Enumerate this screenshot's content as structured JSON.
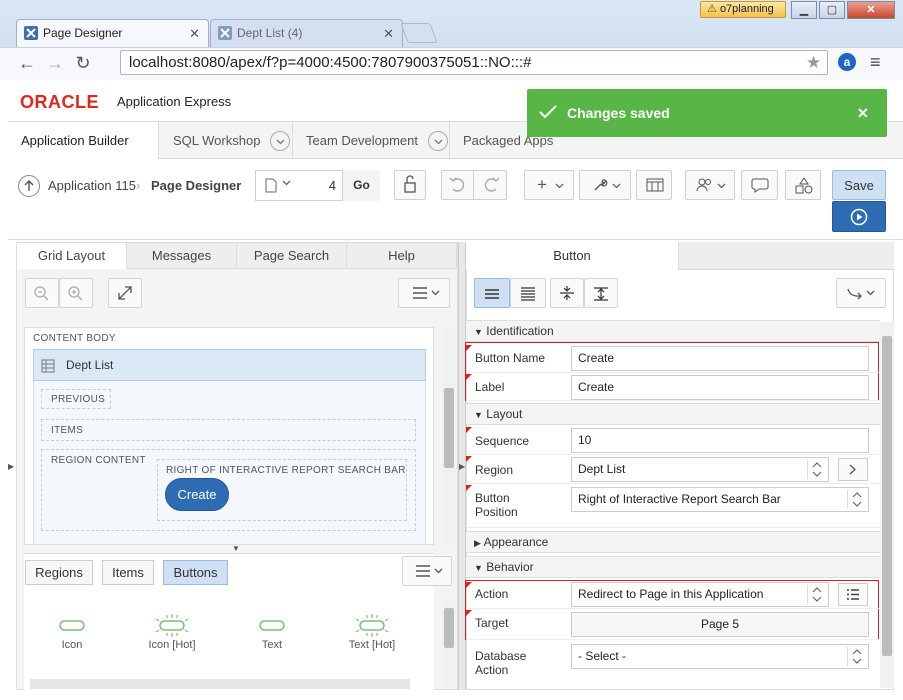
{
  "browser": {
    "tabs": [
      {
        "title": "Page Designer",
        "active": true
      },
      {
        "title": "Dept List (4)",
        "active": false
      }
    ],
    "url": "localhost:8080/apex/f?p=4000:4500:7807900375051::NO:::#",
    "user": "o7planning"
  },
  "header": {
    "brand": "ORACLE",
    "product": "Application Express",
    "tabs": [
      "Application Builder",
      "SQL Workshop",
      "Team Development",
      "Packaged Apps"
    ]
  },
  "toast": {
    "message": "Changes saved"
  },
  "toolbar": {
    "breadcrumb_app": "Application 115",
    "breadcrumb_page": "Page Designer",
    "page_number": "4",
    "go_label": "Go",
    "save_label": "Save"
  },
  "left": {
    "tabs": [
      "Grid Layout",
      "Messages",
      "Page Search",
      "Help"
    ],
    "grid": {
      "content_body": "CONTENT BODY",
      "region_title": "Dept List",
      "previous": "PREVIOUS",
      "items": "ITEMS",
      "region_content": "REGION CONTENT",
      "right_of_bar": "RIGHT OF INTERACTIVE REPORT SEARCH BAR",
      "create_button": "Create"
    },
    "gallery_tabs": [
      "Regions",
      "Items",
      "Buttons"
    ],
    "gallery_items": [
      "Icon",
      "Icon [Hot]",
      "Text",
      "Text [Hot]"
    ]
  },
  "right": {
    "tab": "Button",
    "sections": {
      "identification": "Identification",
      "layout": "Layout",
      "appearance": "Appearance",
      "behavior": "Behavior"
    },
    "props": {
      "button_name_label": "Button Name",
      "button_name_value": "Create",
      "label_label": "Label",
      "label_value": "Create",
      "sequence_label": "Sequence",
      "sequence_value": "10",
      "region_label": "Region",
      "region_value": "Dept List",
      "button_position_label": "Button Position",
      "button_position_value": "Right of Interactive Report Search Bar",
      "action_label": "Action",
      "action_value": "Redirect to Page in this Application",
      "target_label": "Target",
      "target_value": "Page 5",
      "db_action_label": "Database Action",
      "db_action_value": "- Select -"
    }
  },
  "colors": {
    "accent": "#2e6db4",
    "toast": "#58b646",
    "oracle_red": "#e2261c",
    "required_red": "#d81f1f"
  }
}
